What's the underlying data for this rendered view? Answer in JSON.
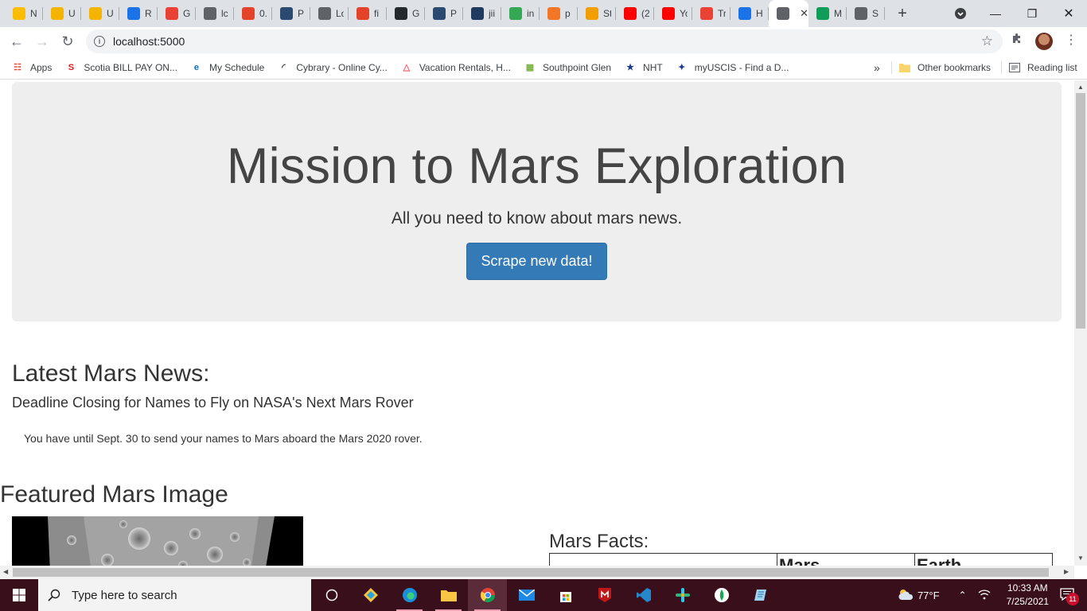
{
  "browser": {
    "tabs": [
      {
        "title": "N",
        "icon": "google-drive-icon",
        "color": "#fbbc04"
      },
      {
        "title": "U",
        "icon": "slides-icon",
        "color": "#f4b400"
      },
      {
        "title": "U",
        "icon": "slides-icon",
        "color": "#f4b400"
      },
      {
        "title": "R",
        "icon": "video-icon",
        "color": "#1a73e8"
      },
      {
        "title": "G",
        "icon": "gear-icon",
        "color": "#e94235"
      },
      {
        "title": "lc",
        "icon": "document-icon",
        "color": "#5f6368"
      },
      {
        "title": "0.",
        "icon": "gitlab-icon",
        "color": "#e24329"
      },
      {
        "title": "P",
        "icon": "tds-icon",
        "color": "#2b4a6f"
      },
      {
        "title": "Lo",
        "icon": "globe-icon",
        "color": "#5f6368"
      },
      {
        "title": "fi",
        "icon": "gitlab-icon",
        "color": "#e24329"
      },
      {
        "title": "G",
        "icon": "github-icon",
        "color": "#24292e"
      },
      {
        "title": "P",
        "icon": "tds-icon",
        "color": "#2b4a6f"
      },
      {
        "title": "jii",
        "icon": "terminal-icon",
        "color": "#1f3a5f"
      },
      {
        "title": "in",
        "icon": "chart-icon",
        "color": "#34a853"
      },
      {
        "title": "p",
        "icon": "jupyter-icon",
        "color": "#f37626"
      },
      {
        "title": "St",
        "icon": "notebook-icon",
        "color": "#f29d00"
      },
      {
        "title": "(2",
        "icon": "youtube-icon",
        "color": "#ff0000"
      },
      {
        "title": "Yo",
        "icon": "youtube-icon",
        "color": "#ff0000"
      },
      {
        "title": "Tr",
        "icon": "gmail-icon",
        "color": "#ea4335"
      },
      {
        "title": "H",
        "icon": "info-icon",
        "color": "#1a73e8"
      },
      {
        "title": "",
        "icon": "globe-icon",
        "color": "#5f6368",
        "active": true
      },
      {
        "title": "M",
        "icon": "sheets-plus-icon",
        "color": "#0f9d58"
      },
      {
        "title": "S",
        "icon": "globe-icon",
        "color": "#5f6368"
      }
    ],
    "url": "localhost:5000",
    "bookmarks": [
      {
        "label": "Apps",
        "icon": "apps-grid-icon"
      },
      {
        "label": "Scotia BILL PAY ON...",
        "icon": "scotia-icon"
      },
      {
        "label": "My Schedule",
        "icon": "schedule-icon"
      },
      {
        "label": "Cybrary - Online Cy...",
        "icon": "cybrary-icon"
      },
      {
        "label": "Vacation Rentals, H...",
        "icon": "airbnb-icon"
      },
      {
        "label": "Southpoint Glen",
        "icon": "building-icon"
      },
      {
        "label": "NHT",
        "icon": "nht-icon"
      },
      {
        "label": "myUSCIS - Find a D...",
        "icon": "uscis-icon"
      }
    ],
    "bookmarks_overflow": "»",
    "other_bookmarks": "Other bookmarks",
    "reading_list": "Reading list"
  },
  "page": {
    "jumbotron": {
      "title": "Mission to Mars Exploration",
      "subtitle": "All you need to know about mars news.",
      "button": "Scrape new data!"
    },
    "news": {
      "heading": "Latest Mars News:",
      "title": "Deadline Closing for Names to Fly on NASA's Next Mars Rover",
      "paragraph": "You have until Sept. 30 to send your names to Mars aboard the Mars 2020 rover."
    },
    "featured": {
      "heading": "Featured Mars Image"
    },
    "facts": {
      "heading": "Mars Facts:",
      "columns": [
        "",
        "Mars",
        "Earth"
      ]
    }
  },
  "taskbar": {
    "search_placeholder": "Type here to search",
    "weather": "77°F",
    "time": "10:33 AM",
    "date": "7/25/2021",
    "notifications": "11"
  }
}
